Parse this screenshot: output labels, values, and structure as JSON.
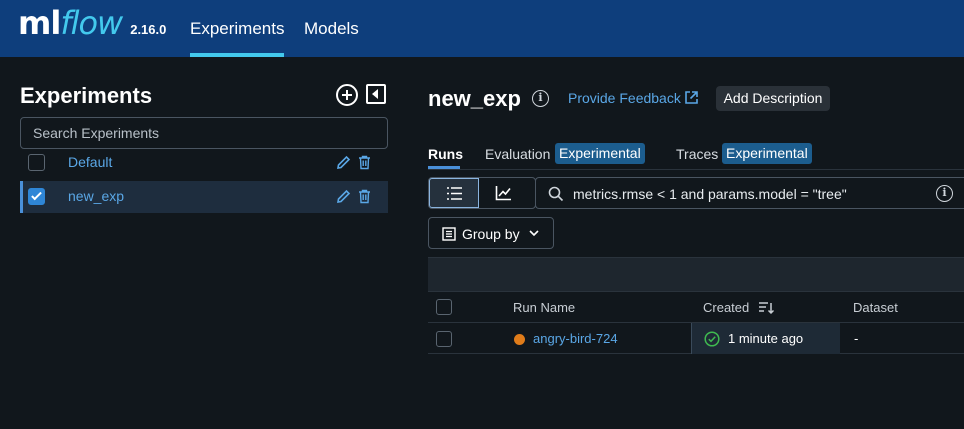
{
  "header": {
    "logo_ml": "ml",
    "logo_flow": "flow",
    "version": "2.16.0",
    "nav": [
      {
        "label": "Experiments",
        "active": true
      },
      {
        "label": "Models",
        "active": false
      }
    ]
  },
  "sidebar": {
    "title": "Experiments",
    "search_placeholder": "Search Experiments",
    "experiments": [
      {
        "name": "Default",
        "checked": false
      },
      {
        "name": "new_exp",
        "checked": true
      }
    ]
  },
  "main": {
    "title": "new_exp",
    "feedback_link": "Provide Feedback",
    "add_description": "Add Description",
    "tabs": [
      {
        "label": "Runs",
        "active": true,
        "badge": ""
      },
      {
        "label": "Evaluation",
        "active": false,
        "badge": "Experimental"
      },
      {
        "label": "Traces",
        "active": false,
        "badge": "Experimental"
      }
    ],
    "filter_query": "metrics.rmse < 1 and params.model = \"tree\"",
    "group_by_label": "Group by",
    "table": {
      "columns": [
        "Run Name",
        "Created",
        "Dataset"
      ],
      "rows": [
        {
          "run_name": "angry-bird-724",
          "status": "finished",
          "created": "1 minute ago",
          "dataset": "-"
        }
      ]
    }
  },
  "colors": {
    "header_bg": "#0e3e7c",
    "accent": "#43c9ed",
    "link": "#5aa7e6",
    "run_color": "#e07c1a",
    "success": "#3fb950"
  }
}
